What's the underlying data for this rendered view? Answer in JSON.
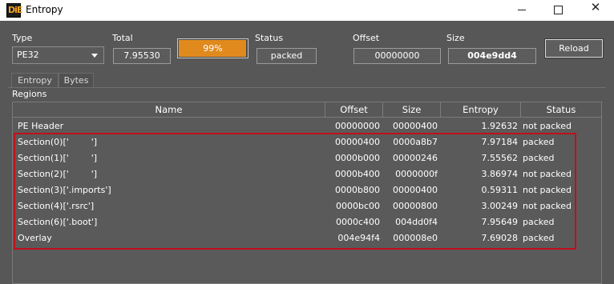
{
  "window": {
    "title": "Entropy",
    "logo_text": "DiE",
    "minimize_glyph": "",
    "maximize_glyph": "",
    "close_glyph": "✕"
  },
  "controls": {
    "type_label": "Type",
    "type_value": "PE32",
    "total_label": "Total",
    "total_value": "7.95530",
    "progress_text": "99%",
    "progress_value": 99,
    "status_label": "Status",
    "status_value": "packed",
    "offset_label": "Offset",
    "offset_value": "00000000",
    "size_label": "Size",
    "size_value": "004e9dd4",
    "reload_label": "Reload"
  },
  "tabs": [
    {
      "label": "Entropy",
      "active": true
    },
    {
      "label": "Bytes",
      "active": false
    }
  ],
  "regions": {
    "label": "Regions",
    "columns": [
      "Name",
      "Offset",
      "Size",
      "Entropy",
      "Status"
    ],
    "rows": [
      {
        "name": "PE Header",
        "offset": "00000000",
        "size": "00000400",
        "entropy": "1.92632",
        "status": "not packed"
      },
      {
        "name": "Section(0)['        ']",
        "offset": "00000400",
        "size": "0000a8b7",
        "entropy": "7.97184",
        "status": "packed"
      },
      {
        "name": "Section(1)['        ']",
        "offset": "0000b000",
        "size": "00000246",
        "entropy": "7.55562",
        "status": "packed"
      },
      {
        "name": "Section(2)['        ']",
        "offset": "0000b400",
        "size": "0000000f",
        "entropy": "3.86974",
        "status": "not packed"
      },
      {
        "name": "Section(3)['.imports']",
        "offset": "0000b800",
        "size": "00000400",
        "entropy": "0.59311",
        "status": "not packed"
      },
      {
        "name": "Section(4)['.rsrc']",
        "offset": "0000bc00",
        "size": "00000800",
        "entropy": "3.00249",
        "status": "not packed"
      },
      {
        "name": "Section(6)['.boot']",
        "offset": "0000c400",
        "size": "004dd0f4",
        "entropy": "7.95649",
        "status": "packed"
      },
      {
        "name": "Overlay",
        "offset": "004e94f4",
        "size": "000008e0",
        "entropy": "7.69028",
        "status": "packed"
      }
    ]
  },
  "colors": {
    "background": "#575757",
    "accent_progress": "#e08a1e",
    "highlight_box": "#c0101a"
  }
}
